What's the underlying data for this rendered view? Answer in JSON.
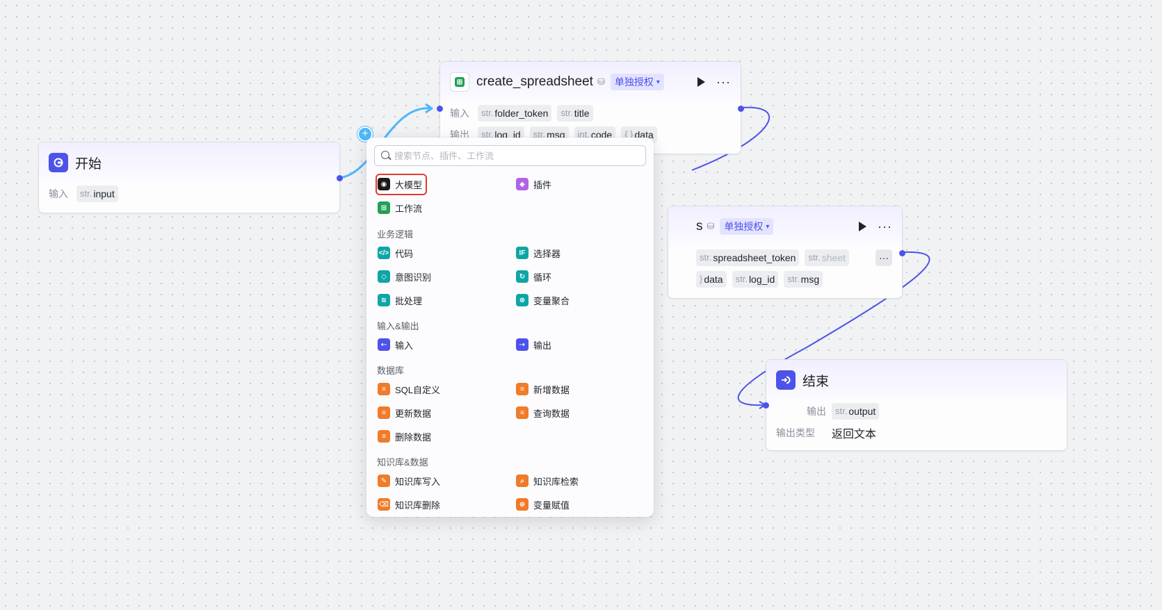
{
  "nodes": {
    "start": {
      "title": "开始",
      "input_label": "输入",
      "params": [
        {
          "type": "str.",
          "name": "input"
        }
      ]
    },
    "create_spreadsheet": {
      "title": "create_spreadsheet",
      "auth_label": "单独授权",
      "input_label": "输入",
      "output_label": "输出",
      "inputs": [
        {
          "type": "str.",
          "name": "folder_token"
        },
        {
          "type": "str.",
          "name": "title"
        }
      ],
      "outputs": [
        {
          "type": "str.",
          "name": "log_id"
        },
        {
          "type": "str.",
          "name": "msg"
        },
        {
          "type": "int.",
          "name": "code"
        },
        {
          "type": "{ }",
          "name": "data"
        }
      ]
    },
    "second": {
      "title_fragment": "s",
      "auth_label": "单独授权",
      "inputs": [
        {
          "type": "str.",
          "name": "spreadsheet_token"
        },
        {
          "type": "str.",
          "name": "sheet"
        }
      ],
      "outputs": [
        {
          "type": "}",
          "name": "data"
        },
        {
          "type": "str.",
          "name": "log_id"
        },
        {
          "type": "str.",
          "name": "msg"
        }
      ]
    },
    "end": {
      "title": "结束",
      "output_label": "输出",
      "output_type_label": "输出类型",
      "output_type_value": "返回文本",
      "params": [
        {
          "type": "str.",
          "name": "output"
        }
      ]
    }
  },
  "menu": {
    "search_placeholder": "搜索节点、插件、工作流",
    "top_items": [
      {
        "label": "大模型",
        "icon": "llm-icon",
        "highlighted": true
      },
      {
        "label": "插件",
        "icon": "plugin-icon"
      },
      {
        "label": "工作流",
        "icon": "workflow-icon"
      }
    ],
    "sections": [
      {
        "title": "业务逻辑",
        "items": [
          {
            "label": "代码",
            "icon": "code-icon"
          },
          {
            "label": "选择器",
            "icon": "condition-icon"
          },
          {
            "label": "意图识别",
            "icon": "intent-icon"
          },
          {
            "label": "循环",
            "icon": "loop-icon"
          },
          {
            "label": "批处理",
            "icon": "batch-icon"
          },
          {
            "label": "变量聚合",
            "icon": "variable-merge-icon"
          }
        ]
      },
      {
        "title": "输入&输出",
        "items": [
          {
            "label": "输入",
            "icon": "input-icon"
          },
          {
            "label": "输出",
            "icon": "output-icon"
          }
        ]
      },
      {
        "title": "数据库",
        "items": [
          {
            "label": "SQL自定义",
            "icon": "database-icon"
          },
          {
            "label": "新增数据",
            "icon": "database-add-icon"
          },
          {
            "label": "更新数据",
            "icon": "database-update-icon"
          },
          {
            "label": "查询数据",
            "icon": "database-query-icon"
          },
          {
            "label": "删除数据",
            "icon": "database-delete-icon"
          }
        ]
      },
      {
        "title": "知识库&数据",
        "items": [
          {
            "label": "知识库写入",
            "icon": "knowledge-write-icon"
          },
          {
            "label": "知识库检索",
            "icon": "knowledge-search-icon"
          },
          {
            "label": "知识库删除",
            "icon": "knowledge-delete-icon"
          },
          {
            "label": "变量赋值",
            "icon": "variable-assign-icon"
          }
        ]
      }
    ]
  },
  "colors": {
    "accent": "#4d53e8",
    "edge_active": "#4db8f8",
    "highlight": "#e23b2e"
  }
}
